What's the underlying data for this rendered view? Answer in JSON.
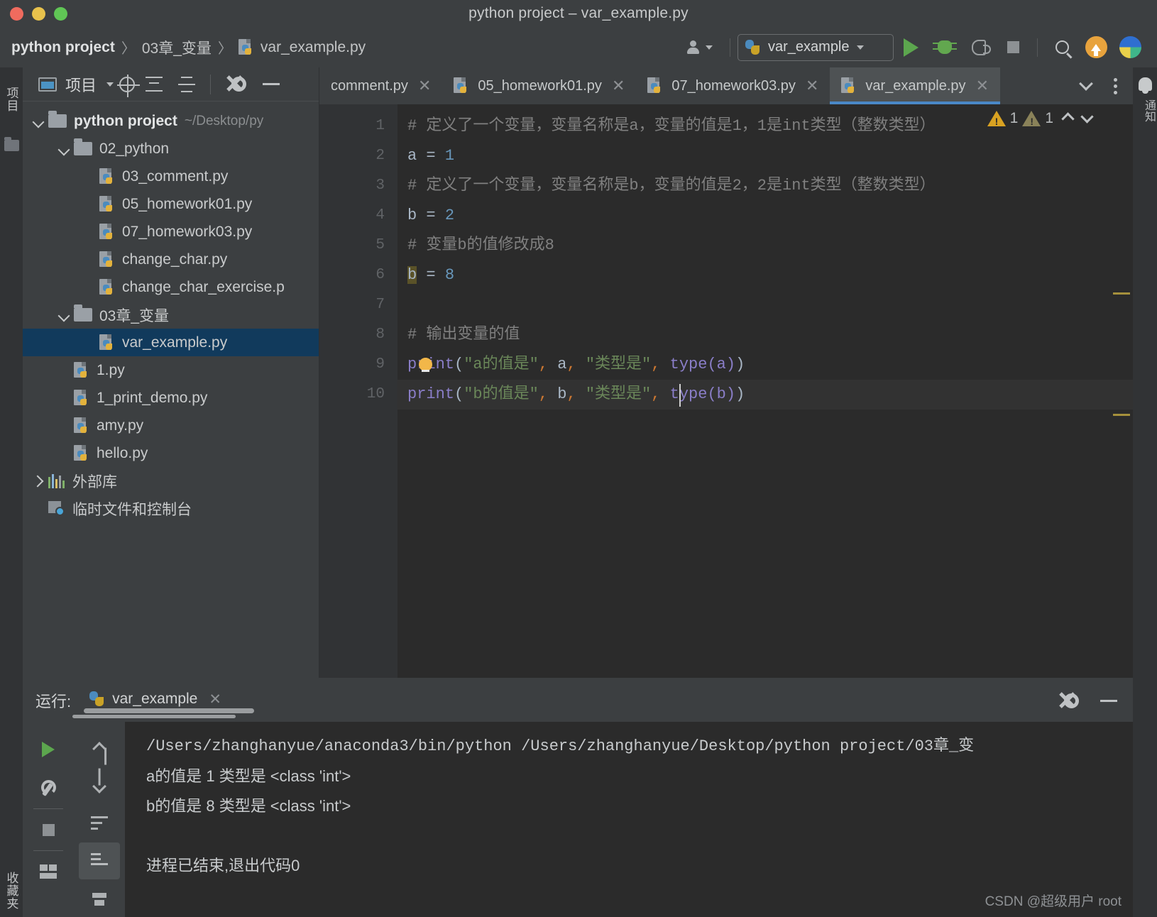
{
  "window": {
    "title": "python project – var_example.py",
    "traffic_lights": [
      "close",
      "minimize",
      "zoom"
    ]
  },
  "breadcrumb": {
    "items": [
      "python project",
      "03章_变量",
      "var_example.py"
    ],
    "separator": "〉"
  },
  "toolbar": {
    "avatar_label": "",
    "run_config_name": "var_example",
    "buttons": [
      {
        "name": "run",
        "label": "Run"
      },
      {
        "name": "debug",
        "label": "Debug"
      },
      {
        "name": "coverage",
        "label": "Run with Coverage"
      },
      {
        "name": "stop",
        "label": "Stop"
      },
      {
        "name": "search",
        "label": "Search Everywhere"
      },
      {
        "name": "update",
        "label": "Update"
      },
      {
        "name": "profile",
        "label": "Profiler"
      }
    ]
  },
  "left_rail": {
    "items": [
      "项目",
      "收藏夹"
    ]
  },
  "right_rail": {
    "items": [
      "通知"
    ]
  },
  "project_panel": {
    "title": "项目",
    "toolbar_icons": [
      "select-opened-file",
      "expand-all",
      "collapse-all",
      "settings",
      "hide"
    ],
    "tree": [
      {
        "indent": 0,
        "chevron": "down",
        "icon": "folder",
        "name": "python project",
        "bold": true,
        "path": "~/Desktop/py",
        "selected": false
      },
      {
        "indent": 1,
        "chevron": "down",
        "icon": "folder",
        "name": "02_python",
        "bold": false,
        "path": "",
        "selected": false
      },
      {
        "indent": 2,
        "chevron": "none",
        "icon": "python",
        "name": "03_comment.py",
        "bold": false,
        "path": "",
        "selected": false
      },
      {
        "indent": 2,
        "chevron": "none",
        "icon": "python",
        "name": "05_homework01.py",
        "bold": false,
        "path": "",
        "selected": false
      },
      {
        "indent": 2,
        "chevron": "none",
        "icon": "python",
        "name": "07_homework03.py",
        "bold": false,
        "path": "",
        "selected": false
      },
      {
        "indent": 2,
        "chevron": "none",
        "icon": "python",
        "name": "change_char.py",
        "bold": false,
        "path": "",
        "selected": false
      },
      {
        "indent": 2,
        "chevron": "none",
        "icon": "python",
        "name": "change_char_exercise.p",
        "bold": false,
        "path": "",
        "selected": false
      },
      {
        "indent": 1,
        "chevron": "down",
        "icon": "folder",
        "name": "03章_变量",
        "bold": false,
        "path": "",
        "selected": false
      },
      {
        "indent": 2,
        "chevron": "none",
        "icon": "python",
        "name": "var_example.py",
        "bold": false,
        "path": "",
        "selected": true
      },
      {
        "indent": 1,
        "chevron": "none",
        "icon": "python",
        "name": "1.py",
        "bold": false,
        "path": "",
        "selected": false
      },
      {
        "indent": 1,
        "chevron": "none",
        "icon": "python",
        "name": "1_print_demo.py",
        "bold": false,
        "path": "",
        "selected": false
      },
      {
        "indent": 1,
        "chevron": "none",
        "icon": "python",
        "name": "amy.py",
        "bold": false,
        "path": "",
        "selected": false
      },
      {
        "indent": 1,
        "chevron": "none",
        "icon": "python",
        "name": "hello.py",
        "bold": false,
        "path": "",
        "selected": false
      },
      {
        "indent": 0,
        "chevron": "right",
        "icon": "library",
        "name": "外部库",
        "bold": false,
        "path": "",
        "selected": false
      },
      {
        "indent": 0,
        "chevron": "none",
        "icon": "console",
        "name": "临时文件和控制台",
        "bold": false,
        "path": "",
        "selected": false
      }
    ]
  },
  "editor": {
    "tabs": [
      {
        "label": "comment.py",
        "active": false,
        "icon": "python",
        "truncated": true
      },
      {
        "label": "05_homework01.py",
        "active": false,
        "icon": "python",
        "truncated": false
      },
      {
        "label": "07_homework03.py",
        "active": false,
        "icon": "python",
        "truncated": false
      },
      {
        "label": "var_example.py",
        "active": true,
        "icon": "python",
        "truncated": false
      }
    ],
    "line_numbers": [
      "1",
      "2",
      "3",
      "4",
      "5",
      "6",
      "7",
      "8",
      "9",
      "10"
    ],
    "code_lines": [
      {
        "n": 1,
        "type": "comment",
        "text": "# 定义了一个变量，变量名称是a，变量的值是1，1是int类型（整数类型）"
      },
      {
        "n": 2,
        "type": "assign",
        "var": "a",
        "op": "=",
        "value": "1"
      },
      {
        "n": 3,
        "type": "comment",
        "text": "# 定义了一个变量，变量名称是b，变量的值是2，2是int类型（整数类型）"
      },
      {
        "n": 4,
        "type": "assign",
        "var": "b",
        "op": "=",
        "value": "2"
      },
      {
        "n": 5,
        "type": "comment",
        "text": "# 变量b的值修改成8"
      },
      {
        "n": 6,
        "type": "assign",
        "var": "b",
        "op": "=",
        "value": "8",
        "highlight_var": true
      },
      {
        "n": 7,
        "type": "blank",
        "text": ""
      },
      {
        "n": 8,
        "type": "comment",
        "text": "# 输出变量的值"
      },
      {
        "n": 9,
        "type": "print",
        "fn": "print",
        "str1": "\"a的值是\"",
        "arg": "a",
        "str2": "\"类型是\"",
        "call": "type(a)",
        "has_bulb": true
      },
      {
        "n": 10,
        "type": "print",
        "fn": "print",
        "str1": "\"b的值是\"",
        "arg": "b",
        "str2": "\"类型是\"",
        "call": "type(b)",
        "has_bulb": false,
        "current": true
      }
    ],
    "inspections": [
      {
        "severity": "warning",
        "count": "1",
        "color": "#d9a222"
      },
      {
        "severity": "weak-warning",
        "count": "1",
        "color": "#8a8259"
      }
    ]
  },
  "run_panel": {
    "label": "运行:",
    "tab_name": "var_example",
    "toolbar_left": [
      "rerun",
      "settings-wrench",
      "stop",
      "layout"
    ],
    "toolbar_right": [
      "up",
      "down",
      "soft-wrap",
      "scroll-to-end",
      "print"
    ],
    "header_right_icons": [
      "gear-icon",
      "minimize-icon"
    ],
    "console_lines": [
      "/Users/zhanghanyue/anaconda3/bin/python /Users/zhanghanyue/Desktop/python project/03章_变",
      "a的值是 1 类型是 <class 'int'>",
      "b的值是 8 类型是 <class 'int'>",
      "",
      "进程已结束,退出代码0"
    ]
  },
  "watermark": {
    "text": "CSDN @超级用户 root"
  },
  "colors": {
    "accent_blue": "#4a88c7",
    "selection_blue": "#113a5c",
    "editor_bg": "#2b2b2b",
    "panel_bg": "#3c3f41",
    "rail_bg": "#313335",
    "comment_gray": "#808080",
    "string_green": "#6a8759",
    "number_blue": "#6897bb",
    "function_purple": "#8a7ec8",
    "comma_orange": "#cc7832",
    "run_green": "#5ca64e",
    "warn_yellow": "#d9a222"
  }
}
